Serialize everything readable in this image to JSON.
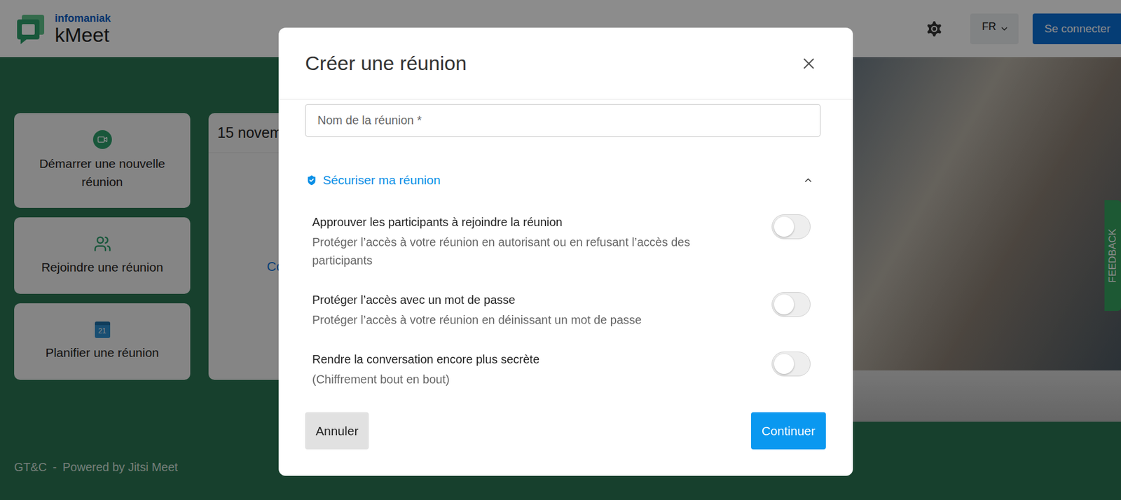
{
  "header": {
    "brand_top": "infomaniak",
    "brand": "kMeet",
    "language": "FR",
    "login": "Se connecter"
  },
  "actions": [
    {
      "label": "Démarrer une nouvelle réunion",
      "badge": ""
    },
    {
      "label": "Rejoindre une réunion",
      "badge": ""
    },
    {
      "label": "Planifier une réunion",
      "badge": "21"
    }
  ],
  "calendar": {
    "date": "15 novem",
    "link": "Co"
  },
  "footer": {
    "terms": "GT&C",
    "separator": "-",
    "powered": "Powered by Jitsi Meet"
  },
  "feedback": "FEEDBACK",
  "dialog": {
    "title": "Créer une réunion",
    "name_placeholder": "Nom de la réunion *",
    "section": {
      "label": "Sécuriser ma réunion",
      "expanded": true
    },
    "options": [
      {
        "title": "Approuver les participants à rejoindre la réunion",
        "description": "Protéger l’accès à votre réunion en autorisant ou en refusant l’accès des participants",
        "on": false
      },
      {
        "title": "Protéger l’accès avec un mot de passe",
        "description": "Protéger l’accès à votre réunion en déinissant un mot de passe",
        "on": false
      },
      {
        "title": "Rendre la conversation encore plus secrète",
        "description": "(Chiffrement bout en bout)",
        "on": false
      }
    ],
    "buttons": {
      "cancel": "Annuler",
      "confirm": "Continuer"
    }
  }
}
